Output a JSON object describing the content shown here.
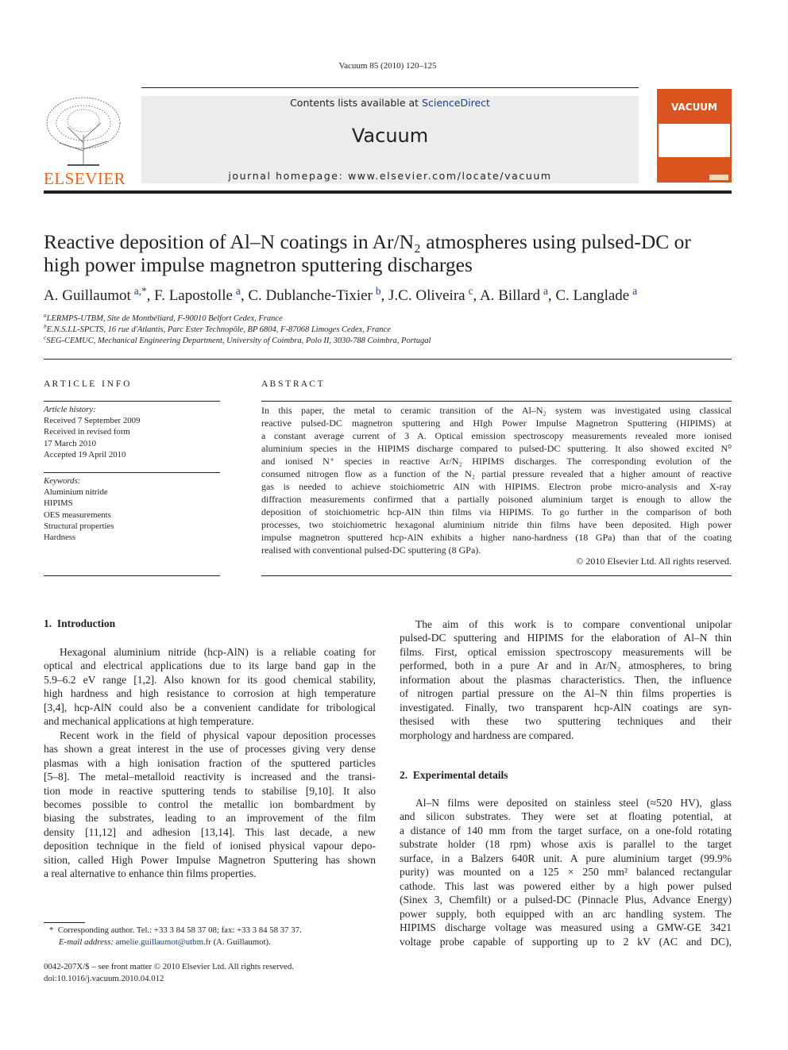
{
  "header": {
    "citation": "Vacuum 85 (2010) 120–125",
    "contents_prefix": "Contents lists available at ",
    "contents_link": "ScienceDirect",
    "journal_name": "Vacuum",
    "homepage": "journal homepage: www.elsevier.com/locate/vacuum",
    "publisher_logo_text": "ELSEVIER",
    "cover_title": "VACUUM",
    "colors": {
      "elsevier_orange": "#e8661c",
      "cover_orange": "#d9541e",
      "link_blue": "#1a3c8c",
      "banner_gray": "#ececec"
    }
  },
  "article": {
    "title_line1": "Reactive deposition of Al–N coatings in Ar/N₂ atmospheres using pulsed-DC or",
    "title_line2": "high power impulse magnetron sputtering discharges",
    "authors": [
      {
        "name": "A. Guillaumot",
        "aff": "a,*"
      },
      {
        "name": "F. Lapostolle",
        "aff": "a"
      },
      {
        "name": "C. Dublanche-Tixier",
        "aff": "b"
      },
      {
        "name": "J.C. Oliveira",
        "aff": "c"
      },
      {
        "name": "A. Billard",
        "aff": "a"
      },
      {
        "name": "C. Langlade",
        "aff": "a"
      }
    ],
    "affiliations": [
      {
        "mark": "a",
        "text": "LERMPS-UTBM, Site de Montbéliard, F-90010 Belfort Cedex, France"
      },
      {
        "mark": "b",
        "text": "E.N.S.I.L-SPCTS, 16 rue d'Atlantis, Parc Ester Technopôle, BP 6804, F-87068 Limoges Cedex, France"
      },
      {
        "mark": "c",
        "text": "SEG-CEMUC, Mechanical Engineering Department, University of Coimbra, Polo II, 3030-788 Coimbra, Portugal"
      }
    ]
  },
  "article_info": {
    "heading": "A R T I C L E   I N F O",
    "history_label": "Article history:",
    "history": [
      "Received 7 September 2009",
      "Received in revised form",
      "17 March 2010",
      "Accepted 19 April 2010"
    ],
    "keywords_label": "Keywords:",
    "keywords": [
      "Aluminium nitride",
      "HIPIMS",
      "OES measurements",
      "Structural properties",
      "Hardness"
    ]
  },
  "abstract": {
    "heading": "A B S T R A C T",
    "lines": [
      "In this paper, the metal to ceramic transition of the Al–N₂ system was investigated using classical",
      "reactive pulsed-DC magnetron sputtering and HIgh Power Impulse Magnetron Sputtering (HIPIMS) at",
      "a constant average current of 3 A. Optical emission spectroscopy measurements revealed more ionised",
      "aluminium species in the HIPIMS discharge compared to pulsed-DC sputtering. It also showed excited N⁰",
      "and ionised N⁺ species in reactive Ar/N₂ HIPIMS discharges. The corresponding evolution of the",
      "consumed nitrogen flow as a function of the N₂ partial pressure revealed that a higher amount of reactive",
      "gas is needed to achieve stoichiometric AlN with HIPIMS. Electron probe micro-analysis and X-ray",
      "diffraction measurements confirmed that a partially poisoned aluminium target is enough to allow the",
      "deposition of stoichiometric hcp-AlN thin films via HIPIMS. To go further in the comparison of both",
      "processes, two stoichiometric hexagonal aluminium nitride thin films have been deposited. High power",
      "impulse magnetron sputtered hcp-AlN exhibits a higher nano-hardness (18 GPa) than that of the coating",
      "realised with conventional pulsed-DC sputtering (8 GPa)."
    ],
    "copyright": "© 2010 Elsevier Ltd. All rights reserved."
  },
  "body": {
    "sec1_heading": "1.  Introduction",
    "sec1_lines": [
      "Hexagonal aluminium nitride (hcp-AlN) is a reliable coating for",
      "optical and electrical applications due to its large band gap in the",
      "5.9–6.2 eV range [1,2]. Also known for its good chemical stability,",
      "high hardness and high resistance to corrosion at high temperature",
      "[3,4], hcp-AlN could also be a convenient candidate for tribological",
      "and mechanical applications at high temperature.",
      "Recent work in the field of physical vapour deposition processes",
      "has shown a great interest in the use of processes giving very dense",
      "plasmas with a high ionisation fraction of the sputtered particles",
      "[5–8]. The metal–metalloid reactivity is increased and the transi-",
      "tion mode in reactive sputtering tends to stabilise [9,10]. It also",
      "becomes possible to control the metallic ion bombardment by",
      "biasing the substrates, leading to an improvement of the film",
      "density [11,12] and adhesion [13,14]. This last decade, a new",
      "deposition technique in the field of ionised physical vapour depo-",
      "sition, called High Power Impulse Magnetron Sputtering has shown",
      "a real alternative to enhance thin films properties."
    ],
    "right_lines": [
      "The aim of this work is to compare conventional unipolar",
      "pulsed-DC sputtering and HIPIMS for the elaboration of Al–N thin",
      "films. First, optical emission spectroscopy measurements will be",
      "performed, both in a pure Ar and in Ar/N₂ atmospheres, to bring",
      "information about the plasmas characteristics. Then, the influence",
      "of nitrogen partial pressure on the Al–N thin films properties is",
      "investigated. Finally, two transparent hcp-AlN coatings are syn-",
      "thesised with these two sputtering techniques and their",
      "morphology and hardness are compared."
    ],
    "sec2_heading": "2.  Experimental details",
    "sec2_lines": [
      "Al–N films were deposited on stainless steel (≈520 HV), glass",
      "and silicon substrates. They were set at floating potential, at",
      "a distance of 140 mm from the target surface, on a one-fold rotating",
      "substrate holder (18 rpm) whose axis is parallel to the target",
      "surface, in a Balzers 640R unit. A pure aluminium target (99.9%",
      "purity) was mounted on a 125 × 250 mm² balanced rectangular",
      "cathode. This last was powered either by a high power pulsed",
      "(Sinex 3, Chemfilt) or a pulsed-DC (Pinnacle Plus, Advance Energy)",
      "power supply, both equipped with an arc handling system. The",
      "HIPIMS discharge voltage was measured using a GMW-GE 3421",
      "voltage probe capable of supporting up to 2 kV (AC and DC),"
    ]
  },
  "footnote": {
    "star": "*",
    "corresponding": "Corresponding author. Tel.: +33 3 84 58 37 08; fax: +33 3 84 58 37 37.",
    "email_label": "E-mail address:",
    "email": "amelie.guillaumot@utbm.fr",
    "email_suffix": "(A. Guillaumot).",
    "issn": "0042-207X/$ – see front matter © 2010 Elsevier Ltd. All rights reserved.",
    "doi": "doi:10.1016/j.vacuum.2010.04.012"
  }
}
